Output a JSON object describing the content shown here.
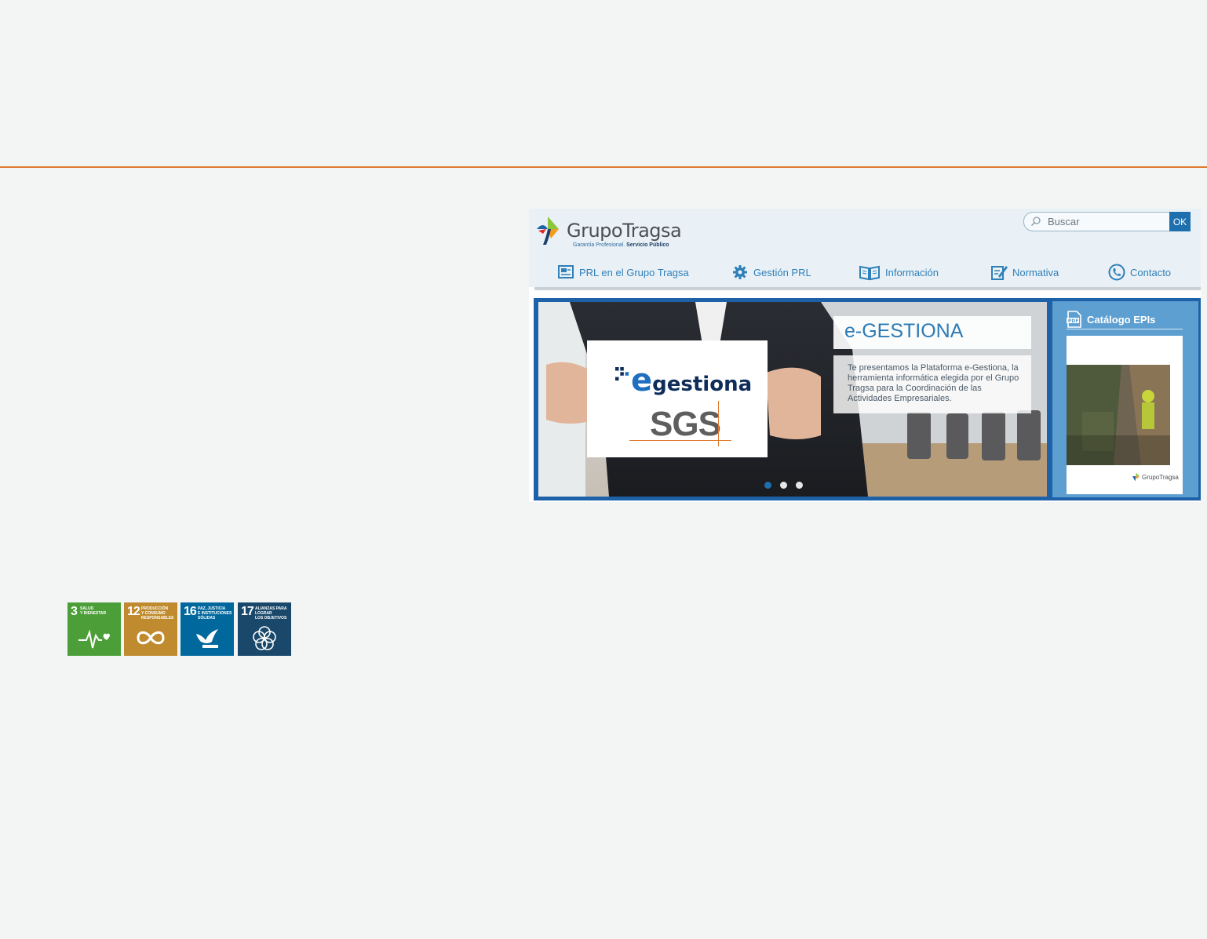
{
  "logo": {
    "brand_a": "Grupo",
    "brand_b": "Tragsa",
    "tagline_a": "Garantía Profesional.",
    "tagline_b": "Servicio Público"
  },
  "search": {
    "placeholder": "Buscar",
    "button_label": "OK"
  },
  "nav": {
    "items": [
      {
        "label": "PRL en el Grupo Tragsa",
        "icon": "presentation-icon"
      },
      {
        "label": "Gestión PRL",
        "icon": "gear-icon"
      },
      {
        "label": "Información",
        "icon": "book-icon"
      },
      {
        "label": "Normativa",
        "icon": "edit-icon"
      },
      {
        "label": "Contacto",
        "icon": "phone-icon"
      }
    ]
  },
  "slider": {
    "title": "e-GESTIONA",
    "description": "Te presentamos la Plataforma e-Gestiona, la herramienta informática elegida por el Grupo Tragsa para la Coordinación de las Actividades Empresariales.",
    "card_brand_e": "e",
    "card_brand_rest": "gestiona",
    "card_sgs": "SGS",
    "dots_total": 3,
    "active_index": 0
  },
  "catalog": {
    "title": "Catálogo EPIs",
    "icon": "pdf-icon",
    "cover_brand": "GrupoTragsa"
  },
  "sdg": [
    {
      "number": "3",
      "label": "SALUD\nY BIENESTAR",
      "color": "#4c9f38",
      "icon": "heartbeat-icon"
    },
    {
      "number": "12",
      "label": "PRODUCCIÓN\nY CONSUMO\nRESPONSABLES",
      "color": "#bf8b2e",
      "icon": "infinity-icon"
    },
    {
      "number": "16",
      "label": "PAZ, JUSTICIA\nE INSTITUCIONES\nSÓLIDAS",
      "color": "#00689d",
      "icon": "dove-icon"
    },
    {
      "number": "17",
      "label": "ALIANZAS PARA\nLOGRAR\nLOS OBJETIVOS",
      "color": "#19486a",
      "icon": "flower-icon"
    }
  ],
  "colors": {
    "accent_rule": "#e07a2e",
    "page_bg": "#f2f5f4",
    "brand_blue": "#1d6fae"
  }
}
